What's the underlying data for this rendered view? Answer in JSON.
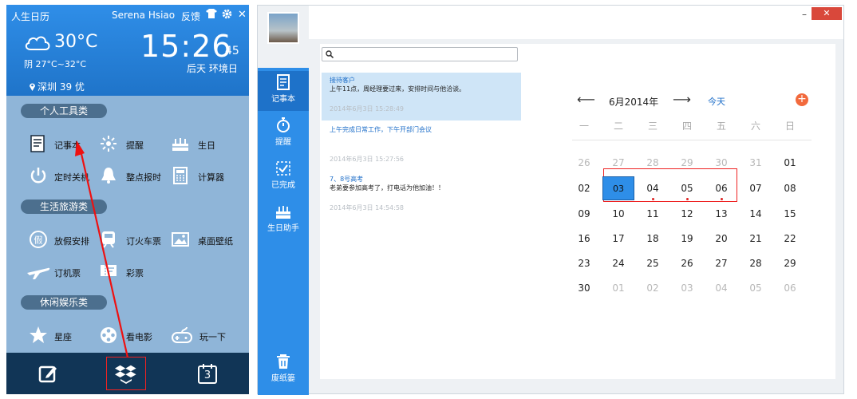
{
  "left": {
    "app_title": "人生日历",
    "user": "Serena Hsiao",
    "feedback": "反馈",
    "shirt_icon": "shirt-icon",
    "settings_icon": "gear-icon",
    "close_label": "✕",
    "weather": {
      "temp": "30°C",
      "condition": "阴  27°C~32°C",
      "icon": "cloud-icon"
    },
    "time": "15:26",
    "seconds": "45",
    "day_note": "后天 环境日",
    "location": "深圳 39 优",
    "sections": [
      {
        "title": "个人工具类",
        "items": [
          {
            "label": "记事本",
            "icon": "notebook-icon"
          },
          {
            "label": "提醒",
            "icon": "reminder-icon"
          },
          {
            "label": "生日",
            "icon": "birthday-icon"
          },
          {
            "label": "定时关机",
            "icon": "power-icon"
          },
          {
            "label": "整点报时",
            "icon": "bell-icon"
          },
          {
            "label": "计算器",
            "icon": "calculator-icon"
          }
        ]
      },
      {
        "title": "生活旅游类",
        "items": [
          {
            "label": "放假安排",
            "icon": "holiday-icon"
          },
          {
            "label": "订火车票",
            "icon": "train-icon"
          },
          {
            "label": "桌面壁纸",
            "icon": "wallpaper-icon"
          },
          {
            "label": "订机票",
            "icon": "plane-icon"
          },
          {
            "label": "彩票",
            "icon": "lottery-icon"
          }
        ]
      },
      {
        "title": "休闲娱乐类",
        "items": [
          {
            "label": "星座",
            "icon": "star-icon"
          },
          {
            "label": "看电影",
            "icon": "film-icon"
          },
          {
            "label": "玩一下",
            "icon": "gamepad-icon"
          }
        ]
      }
    ],
    "bottom": [
      "edit-icon",
      "dropbox-icon",
      "calendar-icon"
    ],
    "calendar_day": "3"
  },
  "right": {
    "window_min": "–",
    "window_close": "✕",
    "sidebar": [
      {
        "label": "记事本",
        "icon": "notebook-icon",
        "active": true
      },
      {
        "label": "提醒",
        "icon": "stopwatch-icon"
      },
      {
        "label": "已完成",
        "icon": "checkbox-icon"
      },
      {
        "label": "生日助手",
        "icon": "cake-icon"
      },
      {
        "label": "废纸篓",
        "icon": "trash-icon"
      }
    ],
    "memos": [
      {
        "tag": "接待客户",
        "text": "上午11点，周经理要过来，安排时间与他洽谈。",
        "ts": "2014年6月3日 15:28:49"
      },
      {
        "tag": "上午完成日常工作，下午开部门会议",
        "text": "",
        "ts": "2014年6月3日 15:27:56"
      },
      {
        "tag": "7、8号高考",
        "text": "老弟要参加高考了，打电话为他加油！！",
        "ts": "2014年6月3日 14:54:58"
      }
    ],
    "calendar": {
      "prev": "⟵",
      "next": "⟶",
      "month": "6月2014年",
      "today_label": "今天",
      "add_label": "+",
      "weekdays": [
        "一",
        "二",
        "三",
        "四",
        "五",
        "六",
        "日"
      ],
      "rows": [
        [
          "26",
          "27",
          "28",
          "29",
          "30",
          "31",
          "01"
        ],
        [
          "02",
          "03",
          "04",
          "05",
          "06",
          "07",
          "08"
        ],
        [
          "09",
          "10",
          "11",
          "12",
          "13",
          "14",
          "15"
        ],
        [
          "16",
          "17",
          "18",
          "19",
          "20",
          "21",
          "22"
        ],
        [
          "23",
          "24",
          "25",
          "26",
          "27",
          "28",
          "29"
        ],
        [
          "30",
          "01",
          "02",
          "03",
          "04",
          "05",
          "06"
        ]
      ]
    }
  }
}
